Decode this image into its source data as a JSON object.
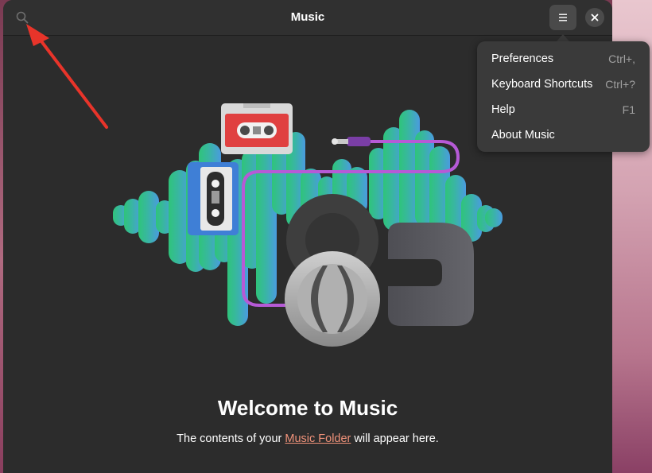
{
  "window": {
    "title": "Music"
  },
  "header": {
    "search_icon": "search-icon",
    "menu_icon": "hamburger-menu-icon",
    "close_icon": "close-icon"
  },
  "menu": {
    "items": [
      {
        "label": "Preferences",
        "accel": "Ctrl+,"
      },
      {
        "label": "Keyboard Shortcuts",
        "accel": "Ctrl+?"
      },
      {
        "label": "Help",
        "accel": "F1"
      },
      {
        "label": "About Music",
        "accel": ""
      }
    ]
  },
  "empty_state": {
    "title": "Welcome to Music",
    "subtitle_before": "The contents of your ",
    "link_label": "Music Folder",
    "subtitle_after": " will appear here."
  },
  "colors": {
    "window_bg": "#2c2c2c",
    "header_bg": "#303030",
    "popover_bg": "#3a3a3a",
    "link": "#f0927a",
    "annotation_arrow": "#e8342a"
  }
}
